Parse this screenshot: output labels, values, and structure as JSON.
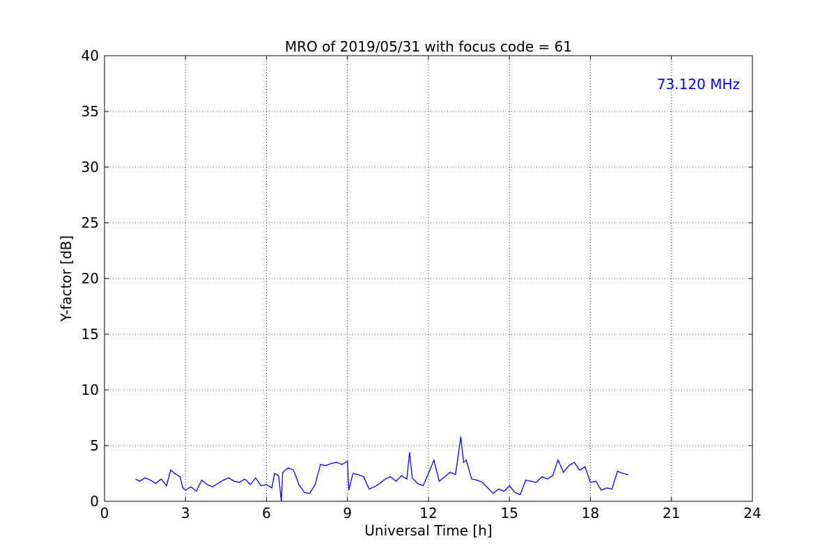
{
  "chart_data": {
    "type": "line",
    "title": "MRO of 2019/05/31 with focus code = 61",
    "xlabel": "Universal Time [h]",
    "ylabel": "Y-factor [dB]",
    "xlim": [
      0,
      24
    ],
    "ylim": [
      0,
      40
    ],
    "xticks": [
      "0",
      "3",
      "6",
      "9",
      "12",
      "15",
      "18",
      "21",
      "24"
    ],
    "yticks": [
      "0",
      "5",
      "10",
      "15",
      "20",
      "25",
      "30",
      "35",
      "40"
    ],
    "grid": true,
    "annotation": {
      "text": "73.120 MHz",
      "color": "#0000ff",
      "placement": "top-right"
    },
    "series": [
      {
        "color": "#0000ff",
        "x": [
          1.15,
          1.3,
          1.5,
          1.7,
          1.9,
          2.1,
          2.3,
          2.45,
          2.6,
          2.8,
          2.9,
          3.0,
          3.2,
          3.4,
          3.6,
          3.8,
          4.0,
          4.2,
          4.4,
          4.6,
          4.8,
          5.0,
          5.2,
          5.4,
          5.6,
          5.8,
          6.0,
          6.2,
          6.3,
          6.45,
          6.55,
          6.6,
          6.8,
          7.0,
          7.2,
          7.4,
          7.6,
          7.8,
          8.0,
          8.2,
          8.4,
          8.6,
          8.8,
          9.0,
          9.05,
          9.2,
          9.4,
          9.6,
          9.8,
          10.0,
          10.2,
          10.4,
          10.6,
          10.8,
          11.0,
          11.2,
          11.3,
          11.4,
          11.6,
          11.8,
          12.0,
          12.2,
          12.4,
          12.6,
          12.8,
          13.0,
          13.2,
          13.3,
          13.4,
          13.6,
          13.8,
          14.0,
          14.2,
          14.4,
          14.6,
          14.8,
          15.0,
          15.2,
          15.4,
          15.6,
          15.8,
          16.0,
          16.2,
          16.4,
          16.6,
          16.8,
          17.0,
          17.2,
          17.4,
          17.6,
          17.8,
          18.0,
          18.2,
          18.4,
          18.6,
          18.8,
          19.0,
          19.2,
          19.4
        ],
        "y": [
          2.0,
          1.8,
          2.1,
          1.9,
          1.6,
          2.0,
          1.4,
          2.8,
          2.5,
          2.2,
          1.2,
          1.0,
          1.3,
          0.9,
          1.9,
          1.5,
          1.3,
          1.6,
          1.9,
          2.1,
          1.8,
          1.7,
          2.0,
          1.5,
          2.1,
          1.4,
          1.5,
          1.2,
          2.5,
          2.3,
          0.0,
          2.6,
          3.0,
          2.8,
          1.5,
          0.8,
          0.7,
          1.5,
          3.3,
          3.2,
          3.4,
          3.5,
          3.3,
          3.6,
          1.0,
          2.5,
          2.4,
          2.2,
          1.1,
          1.3,
          1.6,
          2.0,
          2.2,
          1.8,
          2.3,
          2.0,
          4.4,
          2.1,
          1.6,
          1.4,
          2.5,
          3.7,
          1.8,
          2.2,
          2.6,
          2.4,
          5.8,
          3.5,
          3.7,
          2.0,
          1.9,
          1.7,
          1.2,
          0.7,
          1.1,
          0.9,
          1.4,
          0.8,
          0.6,
          1.9,
          1.8,
          1.7,
          2.2,
          2.0,
          2.3,
          3.7,
          2.6,
          3.2,
          3.5,
          2.8,
          3.1,
          1.7,
          1.8,
          1.0,
          1.2,
          1.1,
          2.7,
          2.5,
          2.4
        ]
      }
    ]
  }
}
